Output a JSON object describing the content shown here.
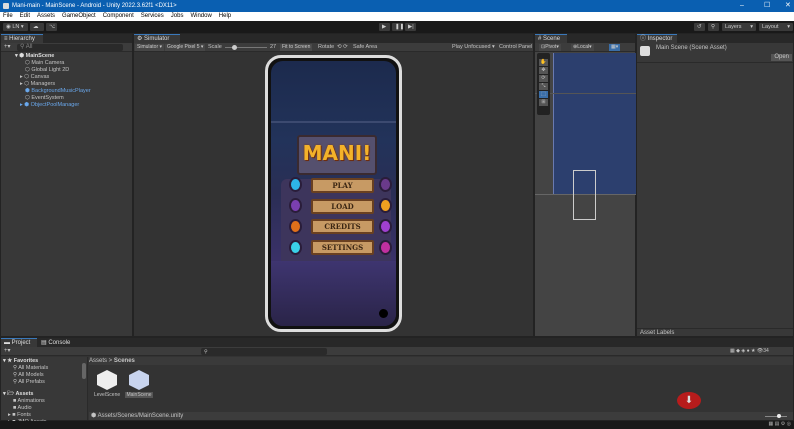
{
  "window": {
    "title": "Mani-main - MainScene - Android - Unity 2022.3.62f1 <DX11>"
  },
  "menu": [
    "File",
    "Edit",
    "Assets",
    "GameObject",
    "Component",
    "Services",
    "Jobs",
    "Window",
    "Help"
  ],
  "toolbar": {
    "account": "LN",
    "layers": "Layers",
    "layout": "Layout"
  },
  "hierarchy": {
    "tab": "Hierarchy",
    "search_placeholder": "All",
    "scene": "MainScene",
    "items": [
      {
        "label": "Main Camera",
        "prefab": false
      },
      {
        "label": "Global Light 2D",
        "prefab": false
      },
      {
        "label": "Canvas",
        "prefab": false
      },
      {
        "label": "Managers",
        "prefab": false
      },
      {
        "label": "BackgroundMusicPlayer",
        "prefab": true
      },
      {
        "label": "EventSystem",
        "prefab": false
      },
      {
        "label": "ObjectPoolManager",
        "prefab": true
      }
    ]
  },
  "simulator": {
    "tab": "Simulator",
    "mode": "Simulator",
    "device": "Google Pixel 5",
    "scale_label": "Scale",
    "scale": "27",
    "fit": "Fit to Screen",
    "rotate": "Rotate",
    "safe_area": "Safe Area",
    "play_mode": "Play Unfocused",
    "control_panel": "Control Panel",
    "game": {
      "title": "MANI!",
      "buttons": [
        "PLAY",
        "LOAD",
        "CREDITS",
        "SETTINGS"
      ]
    }
  },
  "scene": {
    "tab": "Scene",
    "pivot": "Pivot",
    "local": "Local"
  },
  "inspector": {
    "tab": "Inspector",
    "title": "Main Scene (Scene Asset)",
    "open": "Open",
    "asset_labels": "Asset Labels"
  },
  "project": {
    "tabs": [
      "Project",
      "Console"
    ],
    "favorites": "Favorites",
    "fav_items": [
      "All Materials",
      "All Models",
      "All Prefabs"
    ],
    "assets": "Assets",
    "asset_items": [
      "Animations",
      "Audio",
      "Fonts",
      "JMO Assets"
    ],
    "breadcrumb": [
      "Assets",
      "Scenes"
    ],
    "files": [
      "LevelScene",
      "MainScene"
    ],
    "path": "Assets/Scenes/MainScene.unity",
    "hidden_count": "34"
  }
}
